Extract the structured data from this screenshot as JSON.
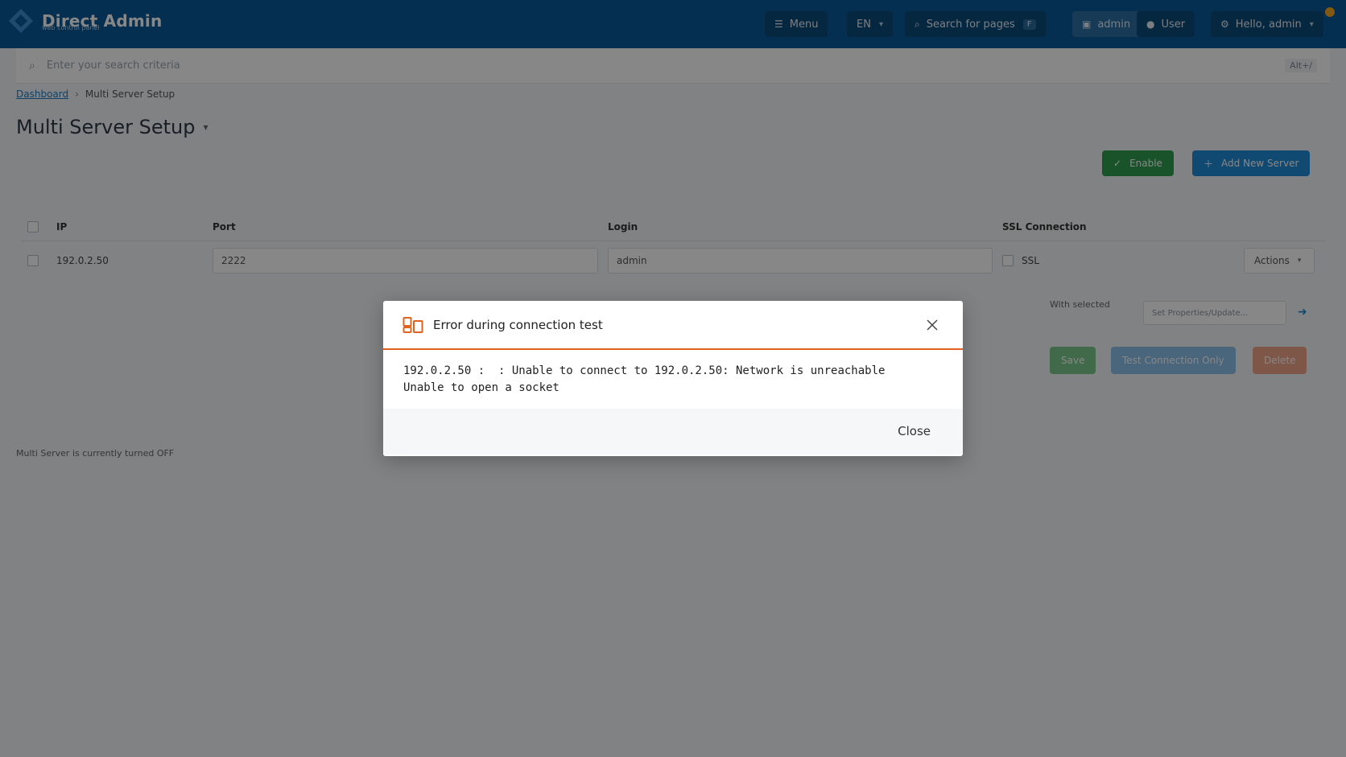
{
  "header": {
    "logo_text": "Direct Admin",
    "logo_sub": "web control panel",
    "menu_label": "Menu",
    "lang_label": "EN",
    "search_label": "Search for pages",
    "search_kbd": "F",
    "admin_label": "admin",
    "user_label": "User",
    "account_label": "Hello, admin"
  },
  "searchbar": {
    "placeholder": "Enter your search criteria",
    "kbd": "Alt+/"
  },
  "breadcrumb": {
    "root": "Dashboard",
    "current": "Multi Server Setup"
  },
  "page": {
    "title": "Multi Server Setup",
    "footer_note": "Multi Server is currently turned OFF"
  },
  "actions": {
    "primary_label": "Enable",
    "secondary_label": "Add New Server"
  },
  "table": {
    "columns": [
      "IP",
      "Port",
      "Login",
      "SSL Connection"
    ],
    "rows": [
      {
        "ip": "192.0.2.50",
        "port": "2222",
        "login": "admin",
        "ssl": "SSL",
        "action": "Actions"
      }
    ]
  },
  "bulk": {
    "with_selected": "With selected",
    "select_placeholder": "Set Properties/Update...",
    "save": "Save",
    "test": "Test Connection Only",
    "delete": "Delete"
  },
  "modal": {
    "title": "Error during connection test",
    "body": "192.0.2.50 :  : Unable to connect to 192.0.2.50: Network is unreachable\nUnable to open a socket",
    "close_label": "Close"
  },
  "colors": {
    "header_bg": "#0a5a97",
    "accent_orange": "#e0631f",
    "green": "#2e9e4f",
    "blue": "#1f8ad6"
  }
}
